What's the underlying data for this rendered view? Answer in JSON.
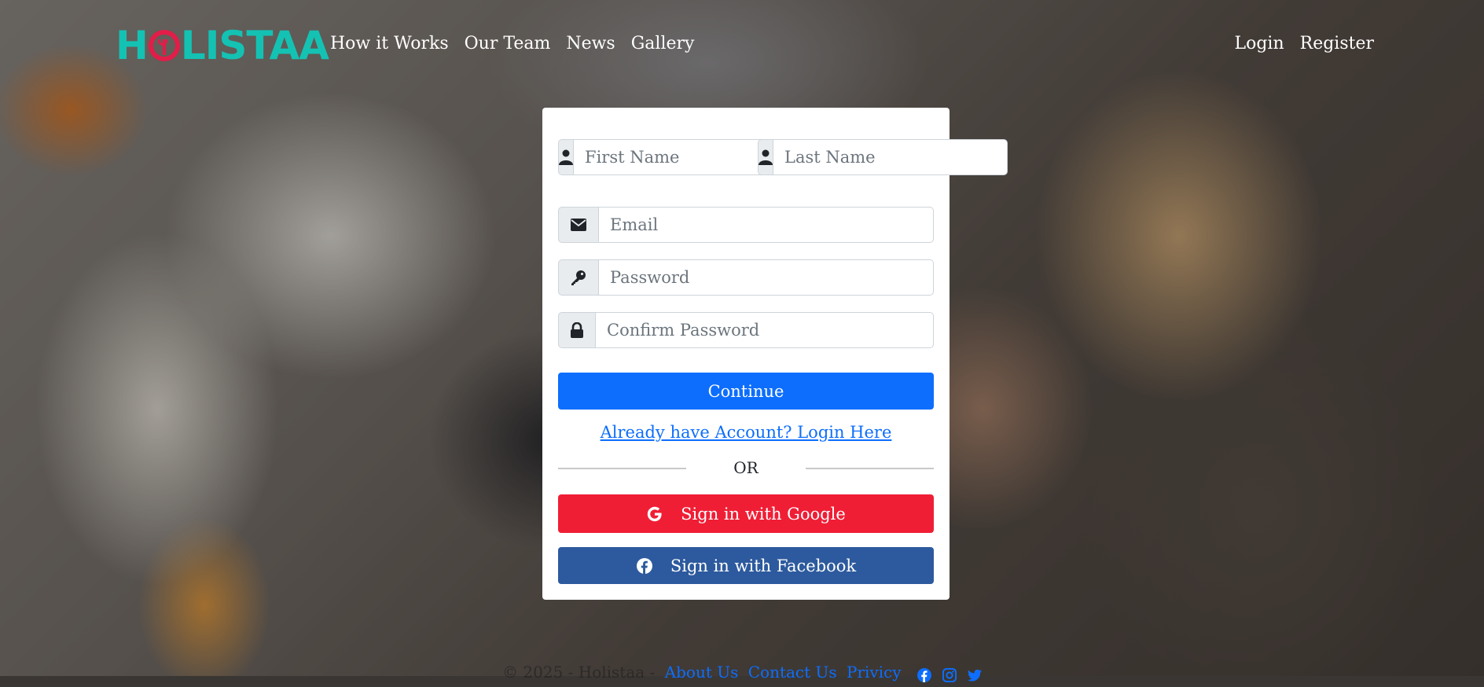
{
  "brand": {
    "name_left": "H",
    "name_right": "LISTAA",
    "logo_color": "#14c2b3",
    "logo_accent": "#e11d48"
  },
  "nav": {
    "links": [
      "How it Works",
      "Our Team",
      "News",
      "Gallery"
    ],
    "right": [
      "Login",
      "Register"
    ]
  },
  "form": {
    "first_name": {
      "placeholder": "First Name",
      "icon": "user-icon"
    },
    "last_name": {
      "placeholder": "Last Name",
      "icon": "user-icon"
    },
    "email": {
      "placeholder": "Email",
      "icon": "envelope-icon"
    },
    "password": {
      "placeholder": "Password",
      "icon": "key-icon"
    },
    "confirm_password": {
      "placeholder": "Confirm Password",
      "icon": "lock-icon"
    },
    "continue_label": "Continue",
    "login_link": "Already have Account? Login Here",
    "divider": "OR",
    "google_label": "Sign in with Google",
    "facebook_label": "Sign in with Facebook"
  },
  "footer": {
    "copyright": "© 2025 - Holistaa -",
    "links": [
      "About Us",
      "Contact Us",
      "Privicy"
    ],
    "social": [
      "facebook-icon",
      "instagram-icon",
      "twitter-icon"
    ]
  },
  "colors": {
    "primary": "#0d6efd",
    "google": "#f01e35",
    "facebook": "#2d5a9e"
  }
}
